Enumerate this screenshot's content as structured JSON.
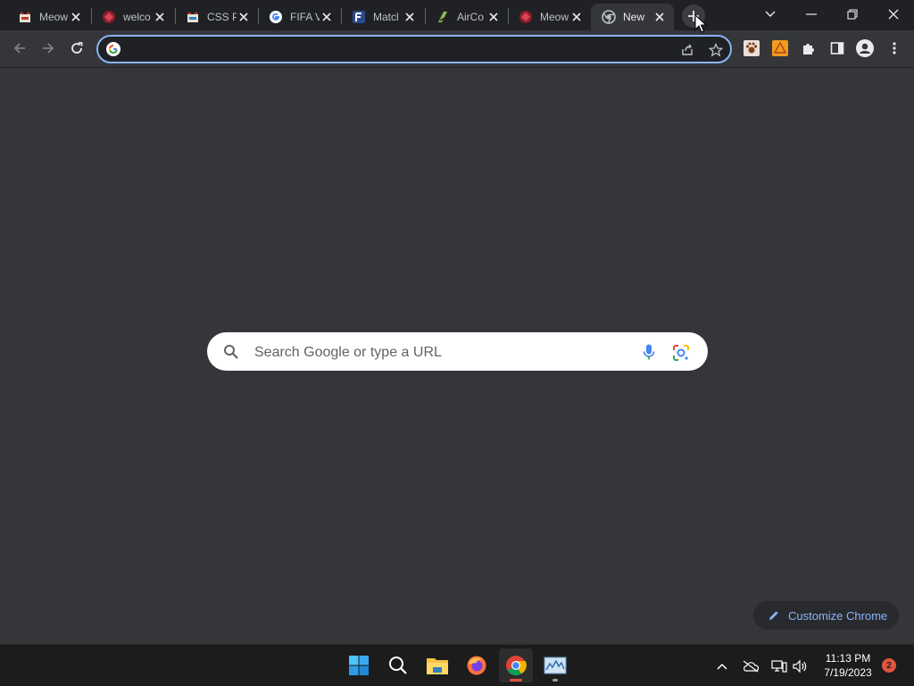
{
  "tabs": [
    {
      "title": "Meow",
      "favicon": "meow-favicon-icon"
    },
    {
      "title": "welco",
      "favicon": "welcome-favicon-icon"
    },
    {
      "title": "CSS P",
      "favicon": "css-favicon-icon"
    },
    {
      "title": "FIFA V",
      "favicon": "google-favicon-icon"
    },
    {
      "title": "Matcl",
      "favicon": "f-favicon-icon"
    },
    {
      "title": "AirCo",
      "favicon": "airco-favicon-icon"
    },
    {
      "title": "Meow",
      "favicon": "meow-favicon-icon"
    },
    {
      "title": "New",
      "favicon": "chrome-favicon-icon",
      "active": true
    }
  ],
  "omnibox": {
    "value": "",
    "placeholder": ""
  },
  "new_tab": {
    "search_placeholder": "Search Google or type a URL",
    "customize_label": "Customize Chrome"
  },
  "taskbar": {
    "apps": [
      "windows-start-icon",
      "search-icon",
      "file-explorer-icon",
      "firefox-icon",
      "chrome-icon",
      "task-manager-icon"
    ],
    "clock_time": "11:13 PM",
    "clock_date": "7/19/2023",
    "notification_count": "2"
  },
  "colors": {
    "accent": "#8ab4f8",
    "page_bg": "#35363a",
    "tabstrip_bg": "#202124",
    "taskbar_bg": "#1c1c1c",
    "badge": "#e0543d"
  }
}
